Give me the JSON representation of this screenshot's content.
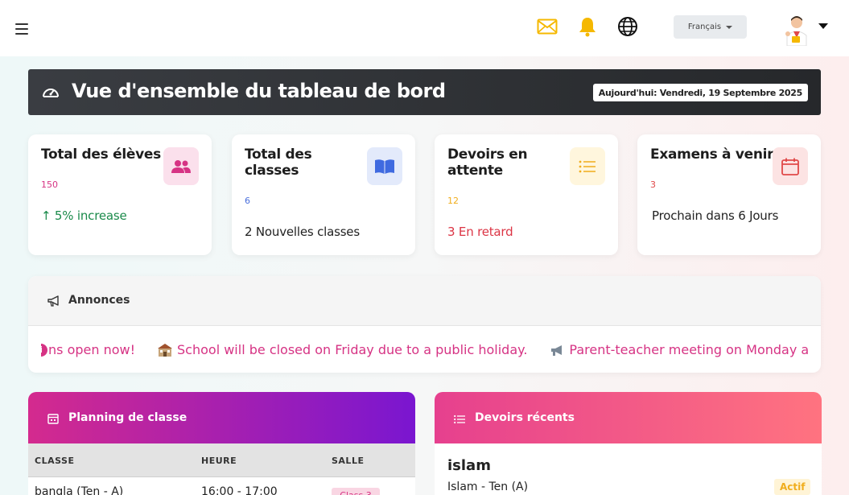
{
  "topbar": {
    "icons": [
      "menu-icon",
      "envelope-icon",
      "bell-icon",
      "globe-icon"
    ],
    "language": "Français",
    "colors": {
      "envelope": "#f5b800",
      "bell": "#f5b800"
    }
  },
  "banner": {
    "title": "Vue d'ensemble du tableau de bord",
    "date": "Aujourd'hui: Vendredi, 19 Septembre 2025"
  },
  "stats": [
    {
      "title": "Total des élèves",
      "value": "150",
      "sub": "↑ 5% increase",
      "icon": "users-icon",
      "color": "#d63384"
    },
    {
      "title": "Total des classes",
      "value": "6",
      "sub": "2 Nouvelles classes",
      "icon": "book-icon",
      "color": "#4a6fdc"
    },
    {
      "title": "Devoirs en attente",
      "value": "12",
      "sub": "3 En retard",
      "icon": "list-icon",
      "color": "#f0ad1c"
    },
    {
      "title": "Examens à venir",
      "value": "3",
      "sub": "Prochain dans 6 Jours",
      "icon": "calendar-icon",
      "color": "#e04848"
    }
  ],
  "announcements": {
    "title": "Annonces",
    "items": [
      "ns open now!",
      "School will be closed on Friday due to a public holiday.",
      "Parent-teacher meeting on Monday a"
    ]
  },
  "schedule": {
    "title": "Planning de classe",
    "columns": [
      "CLASSE",
      "HEURE",
      "SALLE"
    ],
    "rows": [
      {
        "classe": "bangla (Ten - A)",
        "heure": "16:00 - 17:00",
        "salle": "Class 3"
      }
    ]
  },
  "homework": {
    "title": "Devoirs récents",
    "items": [
      {
        "subject": "islam",
        "class": "Islam - Ten (A)",
        "status": "Actif"
      }
    ]
  }
}
